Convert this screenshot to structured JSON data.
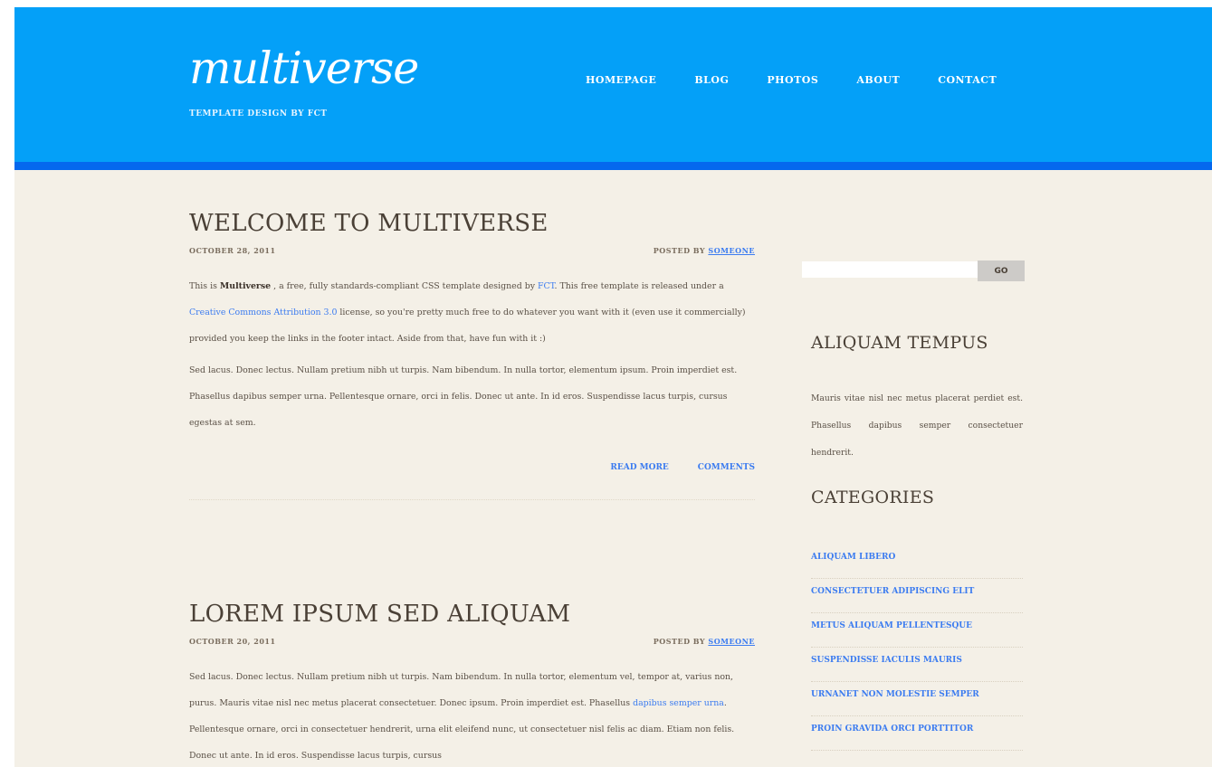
{
  "site": {
    "title": "multiverse",
    "tagline": "TEMPLATE DESIGN BY FCT"
  },
  "nav": [
    "HOMEPAGE",
    "BLOG",
    "PHOTOS",
    "ABOUT",
    "CONTACT"
  ],
  "posts": [
    {
      "title": "WELCOME TO MULTIVERSE",
      "date": "OCTOBER 28, 2011",
      "posted_by": "POSTED BY",
      "author": "SOMEONE",
      "p1_a": "This is ",
      "p1_bold": "Multiverse",
      "p1_b": " , a free, fully standards-compliant CSS template designed by ",
      "p1_link1": "FCT",
      "p1_c": ". This free template is released under a ",
      "p1_link2": "Creative Commons Attribution 3.0",
      "p1_d": " license, so you're pretty much free to do whatever you want with it (even use it commercially) provided you keep the links in the footer intact. Aside from that, have fun with it :)",
      "p2": "Sed lacus. Donec lectus. Nullam pretium nibh ut turpis. Nam bibendum. In nulla tortor, elementum ipsum. Proin imperdiet est. Phasellus dapibus semper urna. Pellentesque ornare, orci in felis. Donec ut ante. In id eros. Suspendisse lacus turpis, cursus egestas at sem.",
      "read_more": "READ MORE",
      "comments": "COMMENTS"
    },
    {
      "title": "LOREM IPSUM SED ALIQUAM",
      "date": "OCTOBER 20, 2011",
      "posted_by": "POSTED BY",
      "author": "SOMEONE",
      "p1_a": "Sed lacus. Donec lectus. Nullam pretium nibh ut turpis. Nam bibendum. In nulla tortor, elementum vel, tempor at, varius non, purus. Mauris vitae nisl nec metus placerat consectetuer. Donec ipsum. Proin imperdiet est. Phasellus ",
      "p1_link": "dapibus semper urna",
      "p1_b": ". Pellentesque ornare, orci in consectetuer hendrerit, urna elit eleifend nunc, ut consectetuer nisl felis ac diam. Etiam non felis. Donec ut ante. In id eros. Suspendisse lacus turpis, cursus"
    }
  ],
  "sidebar": {
    "search_placeholder": "",
    "search_button": "GO",
    "about_title": "ALIQUAM TEMPUS",
    "about_text": "Mauris vitae nisl nec metus placerat perdiet est. Phasellus dapibus semper consectetuer hendrerit.",
    "categories_title": "CATEGORIES",
    "categories": [
      "ALIQUAM LIBERO",
      "CONSECTETUER ADIPISCING ELIT",
      "METUS ALIQUAM PELLENTESQUE",
      "SUSPENDISSE IACULIS MAURIS",
      "URNANET NON MOLESTIE SEMPER",
      "PROIN GRAVIDA ORCI PORTTITOR"
    ]
  }
}
